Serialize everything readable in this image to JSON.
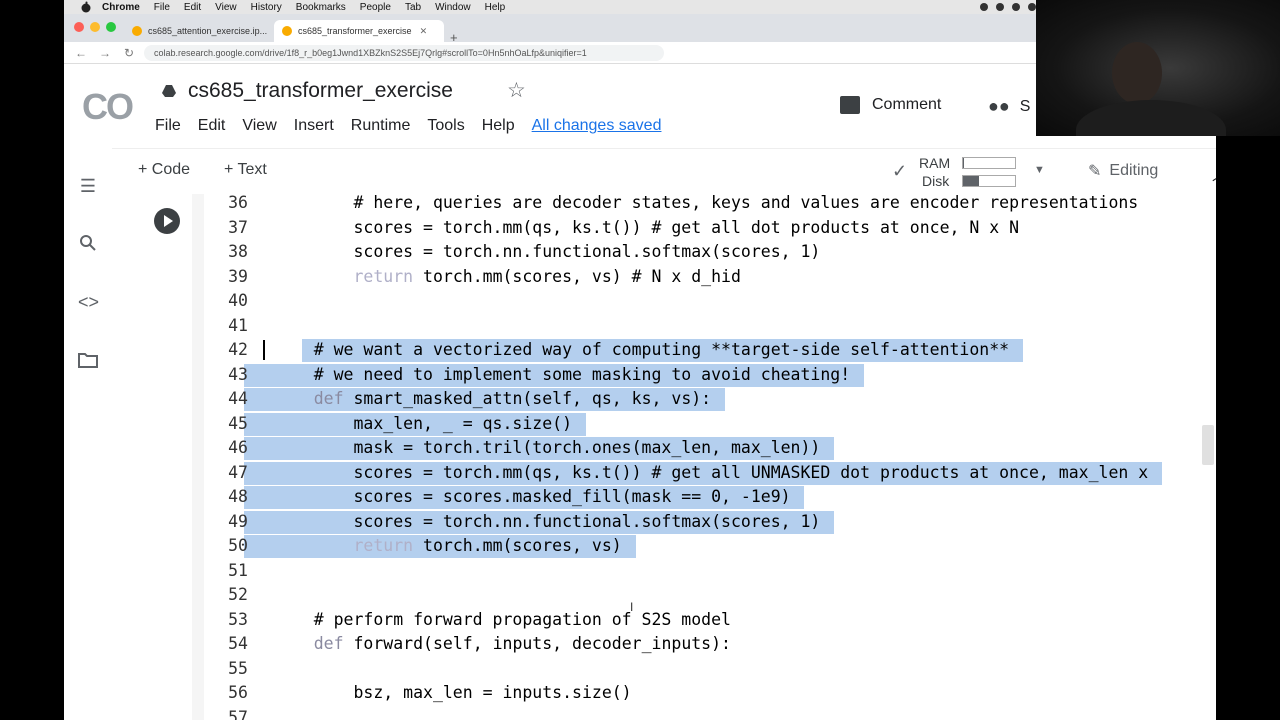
{
  "macbar": {
    "items": [
      "Chrome",
      "File",
      "Edit",
      "View",
      "History",
      "Bookmarks",
      "People",
      "Tab",
      "Window",
      "Help"
    ]
  },
  "tabs": [
    {
      "label": "cs685_attention_exercise.ip..."
    },
    {
      "label": "cs685_transformer_exercise"
    }
  ],
  "address": {
    "url": "colab.research.google.com/drive/1f8_r_b0eg1Jwnd1XBZknS2S5Ej7Qrlg#scrollTo=0Hn5nhOaLfp&uniqifier=1"
  },
  "colab": {
    "logo": "CO",
    "title": "cs685_transformer_exercise",
    "menus": [
      "File",
      "Edit",
      "View",
      "Insert",
      "Runtime",
      "Tools",
      "Help"
    ],
    "save_status": "All changes saved",
    "comment_label": "Comment",
    "share_label": "S"
  },
  "toolbar": {
    "code_label": "+ Code",
    "text_label": "+ Text",
    "ram_label": "RAM",
    "disk_label": "Disk",
    "ram_usage": 0.02,
    "disk_usage": 0.3,
    "editing_label": "Editing"
  },
  "icons": {
    "sidebar": [
      "toc-icon",
      "search-icon",
      "code-snippets-icon",
      "files-icon"
    ]
  },
  "colors": {
    "selection": "#b4cfee",
    "accent": "#1a73e8",
    "keyword": "#8a8aa0"
  },
  "code": {
    "lines": [
      {
        "n": "36",
        "text": "        # here, queries are decoder states, keys and values are encoder representations",
        "selected": false
      },
      {
        "n": "37",
        "text": "        scores = torch.mm(qs, ks.t()) # get all dot products at once, N x N",
        "selected": false
      },
      {
        "n": "38",
        "text": "        scores = torch.nn.functional.softmax(scores, 1)",
        "selected": false
      },
      {
        "n": "39",
        "text": "        return torch.mm(scores, vs) # N x d_hid",
        "selected": false
      },
      {
        "n": "40",
        "text": "",
        "selected": false
      },
      {
        "n": "41",
        "text": "",
        "selected": false
      },
      {
        "n": "42",
        "text": "    # we want a vectorized way of computing **target-side self-attention**",
        "selected": true
      },
      {
        "n": "43",
        "text": "    # we need to implement some masking to avoid cheating!",
        "selected": true
      },
      {
        "n": "44",
        "text": "    def smart_masked_attn(self, qs, ks, vs):",
        "selected": true
      },
      {
        "n": "45",
        "text": "        max_len, _ = qs.size()",
        "selected": true
      },
      {
        "n": "46",
        "text": "        mask = torch.tril(torch.ones(max_len, max_len))",
        "selected": true
      },
      {
        "n": "47",
        "text": "        scores = torch.mm(qs, ks.t()) # get all UNMASKED dot products at once, max_len x",
        "selected": true
      },
      {
        "n": "48",
        "text": "        scores = scores.masked_fill(mask == 0, -1e9)",
        "selected": true
      },
      {
        "n": "49",
        "text": "        scores = torch.nn.functional.softmax(scores, 1)",
        "selected": true
      },
      {
        "n": "50",
        "text": "        return torch.mm(scores, vs)",
        "selected": true
      },
      {
        "n": "51",
        "text": "",
        "selected": false
      },
      {
        "n": "52",
        "text": "",
        "selected": false
      },
      {
        "n": "53",
        "text": "    # perform forward propagation of S2S model",
        "selected": false
      },
      {
        "n": "54",
        "text": "    def forward(self, inputs, decoder_inputs):",
        "selected": false
      },
      {
        "n": "55",
        "text": "",
        "selected": false
      },
      {
        "n": "56",
        "text": "        bsz, max_len = inputs.size()",
        "selected": false
      },
      {
        "n": "57",
        "text": "",
        "selected": false
      }
    ]
  }
}
